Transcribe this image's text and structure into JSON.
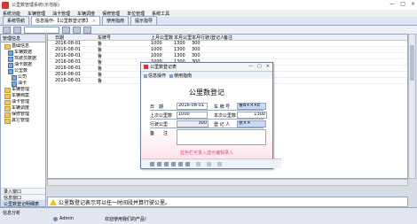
{
  "window": {
    "title": "公里数管理系统(示范版)",
    "min": "—",
    "max": "□",
    "close": "×"
  },
  "menu": [
    "系统功能",
    "车辆管理",
    "油卡管理",
    "车辆调度",
    "保修管理",
    "单位管理",
    "系统工具"
  ],
  "tabs": [
    {
      "label": "系统导航"
    },
    {
      "label": "信息操作-【公里数登记表】"
    },
    {
      "label": "使用指南"
    },
    {
      "label": "提示指导"
    }
  ],
  "left_panel": {
    "title": "管理信息",
    "tree": [
      {
        "label": "基础信息",
        "level": 0,
        "kind": "folder"
      },
      {
        "label": "车辆数据",
        "level": 1,
        "kind": "item"
      },
      {
        "label": "驾驶员数据",
        "level": 1,
        "kind": "item"
      },
      {
        "label": "油卡数据",
        "level": 1,
        "kind": "item"
      },
      {
        "label": "公里数",
        "level": 1,
        "kind": "item"
      },
      {
        "label": "公司",
        "level": 2,
        "kind": "item"
      },
      {
        "label": "油卡",
        "level": 2,
        "kind": "item"
      },
      {
        "label": "车辆管理",
        "level": 0,
        "kind": "folder"
      },
      {
        "label": "车辆档案",
        "level": 0,
        "kind": "folder"
      },
      {
        "label": "油卡管理",
        "level": 0,
        "kind": "folder"
      },
      {
        "label": "车辆调度",
        "level": 0,
        "kind": "folder"
      },
      {
        "label": "保修管理",
        "level": 0,
        "kind": "folder"
      },
      {
        "label": "其它管理",
        "level": 0,
        "kind": "folder"
      }
    ],
    "bottom_nav": [
      "录入窗口",
      "信息窗口",
      "公里数登记明细表"
    ],
    "footer": "信息分析"
  },
  "grid": {
    "columns": [
      "",
      "日期",
      "车牌号",
      "上月公里数",
      "本月公里数",
      "本月行驶公里数",
      "登记人",
      "备注"
    ],
    "rows": [
      [
        "",
        "2016-08-01",
        "鲁",
        "1000",
        "1300",
        "300",
        "",
        ""
      ],
      [
        "",
        "2016-08-01",
        "鲁",
        "1000",
        "1300",
        "300",
        "",
        ""
      ],
      [
        "",
        "2016-08-01",
        "鲁",
        "1000",
        "1300",
        "300",
        "",
        ""
      ],
      [
        "",
        "2016-08-01",
        "鲁",
        "1000",
        "1300",
        "300",
        "",
        ""
      ],
      [
        "",
        "2016-08-01",
        "鲁",
        "1000",
        "1300",
        "300",
        "",
        ""
      ],
      [
        "",
        "2016-08-01",
        "鲁",
        "1000",
        "1300",
        "300",
        "",
        ""
      ],
      [
        "",
        "2016-08-01",
        "鲁",
        "1000",
        "1300",
        "300",
        "",
        ""
      ]
    ]
  },
  "dialog": {
    "title": "公里数登记",
    "window_title": "公里数登记表",
    "tools": [
      "信息操作",
      "使用指南"
    ],
    "heading": "公里数登记",
    "fields": {
      "date_label": "日　期",
      "date_value": "2016-08-01",
      "plate_label": "车 牌 号",
      "plate_value": "鲁B×××E",
      "last_label": "上次公里数",
      "last_value": "1000",
      "current_label": "本次公里数",
      "current_value": "1300",
      "distance_label": "行驶公里",
      "distance_value": "300",
      "registrar_label": "登 记 人",
      "registrar_value": "张××",
      "remark_label": "备　　注"
    },
    "note": "蓝色栏可录入选可编辑录入"
  },
  "notice": {
    "text": "公里数登记表示可以任一时间段并算行驶公里。"
  },
  "status": {
    "label": "信息分析",
    "user": "Admin",
    "message": "欢迎使用我们的产品!"
  }
}
